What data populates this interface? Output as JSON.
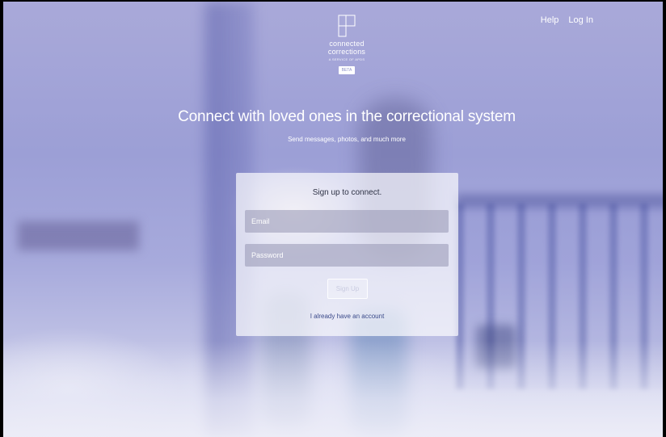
{
  "nav": {
    "help": "Help",
    "login": "Log In"
  },
  "brand": {
    "name_line1": "connected",
    "name_line2": "corrections",
    "subtitle": "A SERVICE OF APDS",
    "badge": "BETA",
    "logo_icon": "logo-mark-icon"
  },
  "hero": {
    "headline": "Connect with loved ones in the correctional system",
    "subheadline": "Send messages, photos, and much more"
  },
  "form": {
    "title": "Sign up to connect.",
    "email_placeholder": "Email",
    "password_placeholder": "Password",
    "submit_label": "Sign Up",
    "existing_account_link": "I already have an account"
  },
  "colors": {
    "background_tint": "#9c9fd6",
    "link": "#3b4a8a",
    "field_bg": "#9696b2"
  }
}
